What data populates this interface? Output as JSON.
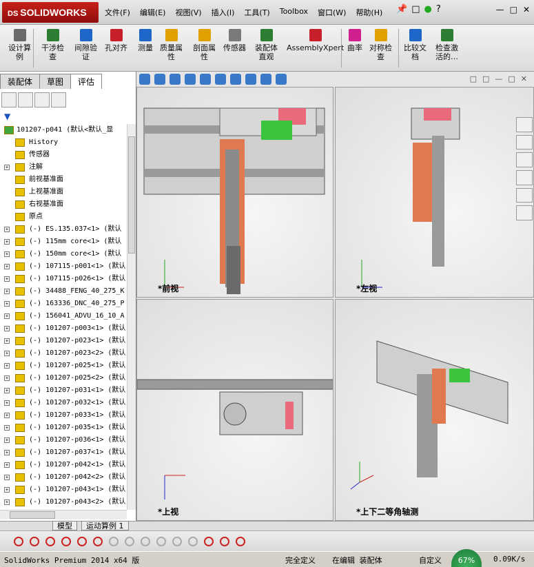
{
  "app": {
    "brand": "SOLIDWORKS",
    "brand_prefix": "DS"
  },
  "menu": [
    "文件(F)",
    "编辑(E)",
    "视图(V)",
    "插入(I)",
    "工具(T)",
    "Toolbox",
    "窗口(W)",
    "帮助(H)"
  ],
  "cmd": [
    {
      "label": "设计算\n例",
      "icon": "design-study-icon",
      "color": "#6a6a6a"
    },
    {
      "label": "干涉检\n查",
      "icon": "interference-icon",
      "color": "#2e7d32"
    },
    {
      "label": "间隙验\n证",
      "icon": "clearance-icon",
      "color": "#1e66c8"
    },
    {
      "label": "孔对齐",
      "icon": "hole-align-icon",
      "color": "#c8202a"
    },
    {
      "label": "测量",
      "icon": "measure-icon",
      "color": "#1e66c8"
    },
    {
      "label": "质量属\n性",
      "icon": "mass-props-icon",
      "color": "#e0a000"
    },
    {
      "label": "剖面属\n性",
      "icon": "section-props-icon",
      "color": "#e0a000"
    },
    {
      "label": "传感器",
      "icon": "sensor-icon",
      "color": "#7a7a7a"
    },
    {
      "label": "装配体\n直观",
      "icon": "assembly-visualization-icon",
      "color": "#2e7d32"
    },
    {
      "label": "AssemblyXpert",
      "icon": "assemblyxpert-icon",
      "color": "#c8202a"
    },
    {
      "label": "曲率",
      "icon": "curvature-icon",
      "color": "#d02090"
    },
    {
      "label": "对称检\n查",
      "icon": "symmetry-icon",
      "color": "#e0a000"
    },
    {
      "label": "比较文\n档",
      "icon": "compare-icon",
      "color": "#1e66c8"
    },
    {
      "label": "检查激\n活的…",
      "icon": "check-active-icon",
      "color": "#2e7d32"
    }
  ],
  "panel_tabs": [
    "装配体",
    "草图",
    "评估"
  ],
  "tree": {
    "root": "101207-p041  (默认<默认_显",
    "items": [
      {
        "t": "History",
        "ic": "history-icon",
        "plus": false
      },
      {
        "t": "传感器",
        "ic": "sensor-icon",
        "plus": false
      },
      {
        "t": "注解",
        "ic": "annotation-icon",
        "plus": true
      },
      {
        "t": "前视基准面",
        "ic": "plane-icon",
        "plus": false
      },
      {
        "t": "上视基准面",
        "ic": "plane-icon",
        "plus": false
      },
      {
        "t": "右视基准面",
        "ic": "plane-icon",
        "plus": false
      },
      {
        "t": "原点",
        "ic": "origin-icon",
        "plus": false
      },
      {
        "t": "(-) ES.135.037<1> (默认",
        "ic": "part-icon",
        "plus": true
      },
      {
        "t": "(-) 115mm core<1> (默认",
        "ic": "part-icon",
        "plus": true
      },
      {
        "t": "(-) 150mm core<1> (默认",
        "ic": "part-icon",
        "plus": true
      },
      {
        "t": "(-) 107115-p001<1> (默认",
        "ic": "part-icon",
        "plus": true
      },
      {
        "t": "(-) 107115-p026<1> (默认",
        "ic": "part-icon",
        "plus": true
      },
      {
        "t": "(-) 34488_FENG_40_275_K",
        "ic": "part-icon",
        "plus": true
      },
      {
        "t": "(-) 163336_DNC_40_275_P",
        "ic": "part-icon",
        "plus": true
      },
      {
        "t": "(-) 156041_ADVU_16_10_A",
        "ic": "part-icon",
        "plus": true
      },
      {
        "t": "(-) 101207-p003<1> (默认",
        "ic": "part-icon",
        "plus": true
      },
      {
        "t": "(-) 101207-p023<1> (默认",
        "ic": "part-icon",
        "plus": true
      },
      {
        "t": "(-) 101207-p023<2> (默认",
        "ic": "part-icon",
        "plus": true
      },
      {
        "t": "(-) 101207-p025<1> (默认",
        "ic": "part-icon",
        "plus": true
      },
      {
        "t": "(-) 101207-p025<2> (默认",
        "ic": "part-icon",
        "plus": true
      },
      {
        "t": "(-) 101207-p031<1> (默认",
        "ic": "part-icon",
        "plus": true
      },
      {
        "t": "(-) 101207-p032<1> (默认",
        "ic": "part-icon",
        "plus": true
      },
      {
        "t": "(-) 101207-p033<1> (默认",
        "ic": "part-icon",
        "plus": true
      },
      {
        "t": "(-) 101207-p035<1> (默认",
        "ic": "part-icon",
        "plus": true
      },
      {
        "t": "(-) 101207-p036<1> (默认",
        "ic": "part-icon",
        "plus": true
      },
      {
        "t": "(-) 101207-p037<1> (默认",
        "ic": "part-icon",
        "plus": true
      },
      {
        "t": "(-) 101207-p042<1> (默认",
        "ic": "part-icon",
        "plus": true
      },
      {
        "t": "(-) 101207-p042<2> (默认",
        "ic": "part-icon",
        "plus": true
      },
      {
        "t": "(-) 101207-p043<1> (默认",
        "ic": "part-icon",
        "plus": true
      },
      {
        "t": "(-) 101207-p043<2> (默认",
        "ic": "part-icon",
        "plus": true
      }
    ]
  },
  "views": {
    "front": "*前视",
    "left": "*左视",
    "top": "*上视",
    "iso": "*上下二等角轴测"
  },
  "axes": {
    "x": "X",
    "y": "Y",
    "z": "Z"
  },
  "bottom_tabs": [
    "模型",
    "运动算例 1"
  ],
  "status": {
    "left": "SolidWorks Premium 2014 x64 版",
    "a": "完全定义",
    "b": "在编辑 装配体",
    "c": "自定义",
    "gauge": "67%",
    "speed": "0.09K/s"
  },
  "colors": {
    "accent": "#c8201a",
    "viewport_bg": "#e6e6e6"
  }
}
